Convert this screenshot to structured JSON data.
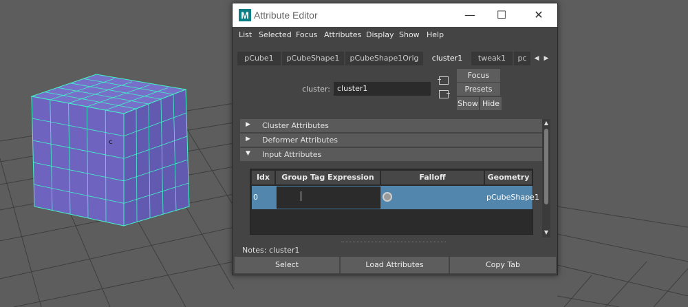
{
  "window": {
    "title": "Attribute Editor",
    "logo": "M"
  },
  "menubar": {
    "items": [
      "List",
      "Selected",
      "Focus",
      "Attributes",
      "Display",
      "Show",
      "Help"
    ]
  },
  "tabs": [
    "pCube1",
    "pCubeShape1",
    "pCubeShape1Orig",
    "cluster1",
    "tweak1",
    "pc"
  ],
  "active_tab": "cluster1",
  "node_field": {
    "label": "cluster:",
    "value": "cluster1"
  },
  "side_buttons": {
    "focus": "Focus",
    "presets": "Presets",
    "show": "Show",
    "hide": "Hide"
  },
  "sections": [
    {
      "label": "Cluster Attributes",
      "expanded": false
    },
    {
      "label": "Deformer Attributes",
      "expanded": false
    },
    {
      "label": "Input Attributes",
      "expanded": true
    }
  ],
  "table": {
    "headers": [
      "Idx",
      "Group Tag Expression",
      "Falloff",
      "Geometry"
    ],
    "rows": [
      {
        "idx": "0",
        "expression": "",
        "falloff": "",
        "geometry": "pCubeShape1"
      }
    ]
  },
  "notes": {
    "label": "Notes:",
    "value": "cluster1"
  },
  "bottom_buttons": [
    "Select",
    "Load Attributes",
    "Copy Tab"
  ],
  "viewport": {
    "marker": "c"
  },
  "colors": {
    "cube_face": "#6e64bf",
    "cube_edge": "#42f5c8",
    "panel_bg": "#444444",
    "selected_row": "#5286ac"
  }
}
